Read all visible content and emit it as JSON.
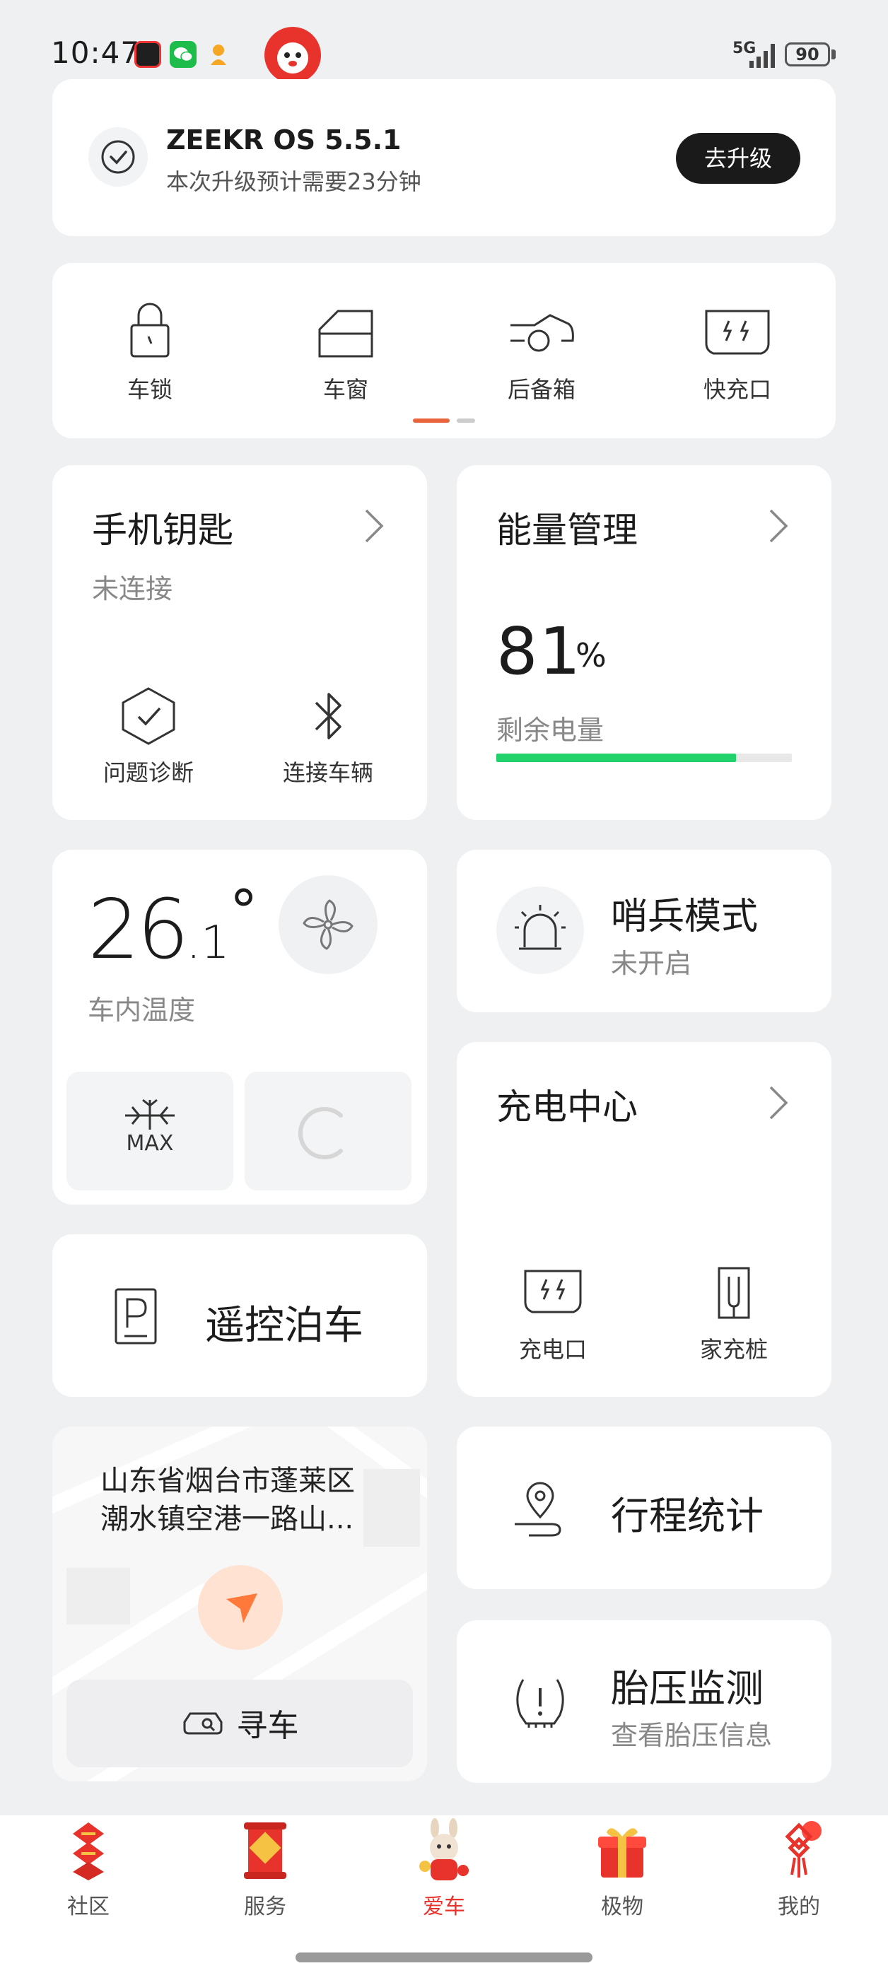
{
  "status_bar": {
    "time": "10:47",
    "network": "5G",
    "battery": "90"
  },
  "update": {
    "title": "ZEEKR OS 5.5.1",
    "subtitle": "本次升级预计需要23分钟",
    "button": "去升级"
  },
  "quick_controls": [
    {
      "label": "车锁",
      "icon": "lock-icon"
    },
    {
      "label": "车窗",
      "icon": "window-icon"
    },
    {
      "label": "后备箱",
      "icon": "trunk-icon"
    },
    {
      "label": "快充口",
      "icon": "fast-charge-port-icon"
    }
  ],
  "phone_key": {
    "title": "手机钥匙",
    "status": "未连接",
    "actions": [
      "问题诊断",
      "连接车辆"
    ]
  },
  "energy": {
    "title": "能量管理",
    "percent": "81",
    "unit": "%",
    "label": "剩余电量",
    "level": 0.81,
    "bar_color": "#21d26a"
  },
  "climate": {
    "temp_int": "26",
    "temp_dec": ".1",
    "degree": "°",
    "label": "车内温度",
    "max_label": "MAX"
  },
  "sentry": {
    "title": "哨兵模式",
    "status": "未开启"
  },
  "charging": {
    "title": "充电中心",
    "items": [
      "充电口",
      "家充桩"
    ]
  },
  "parking": {
    "title": "遥控泊车"
  },
  "location": {
    "address_line1": "山东省烟台市蓬莱区",
    "address_line2": "潮水镇空港一路山...",
    "find_car": "寻车",
    "accent": "#ff7a3a"
  },
  "trip": {
    "title": "行程统计"
  },
  "tire": {
    "title": "胎压监测",
    "subtitle": "查看胎压信息"
  },
  "nav": [
    {
      "label": "社区",
      "icon": "community-icon"
    },
    {
      "label": "服务",
      "icon": "service-icon"
    },
    {
      "label": "爱车",
      "icon": "my-car-icon",
      "active": true,
      "color": "#e8322c"
    },
    {
      "label": "极物",
      "icon": "shop-gift-icon"
    },
    {
      "label": "我的",
      "icon": "profile-knot-icon"
    }
  ]
}
